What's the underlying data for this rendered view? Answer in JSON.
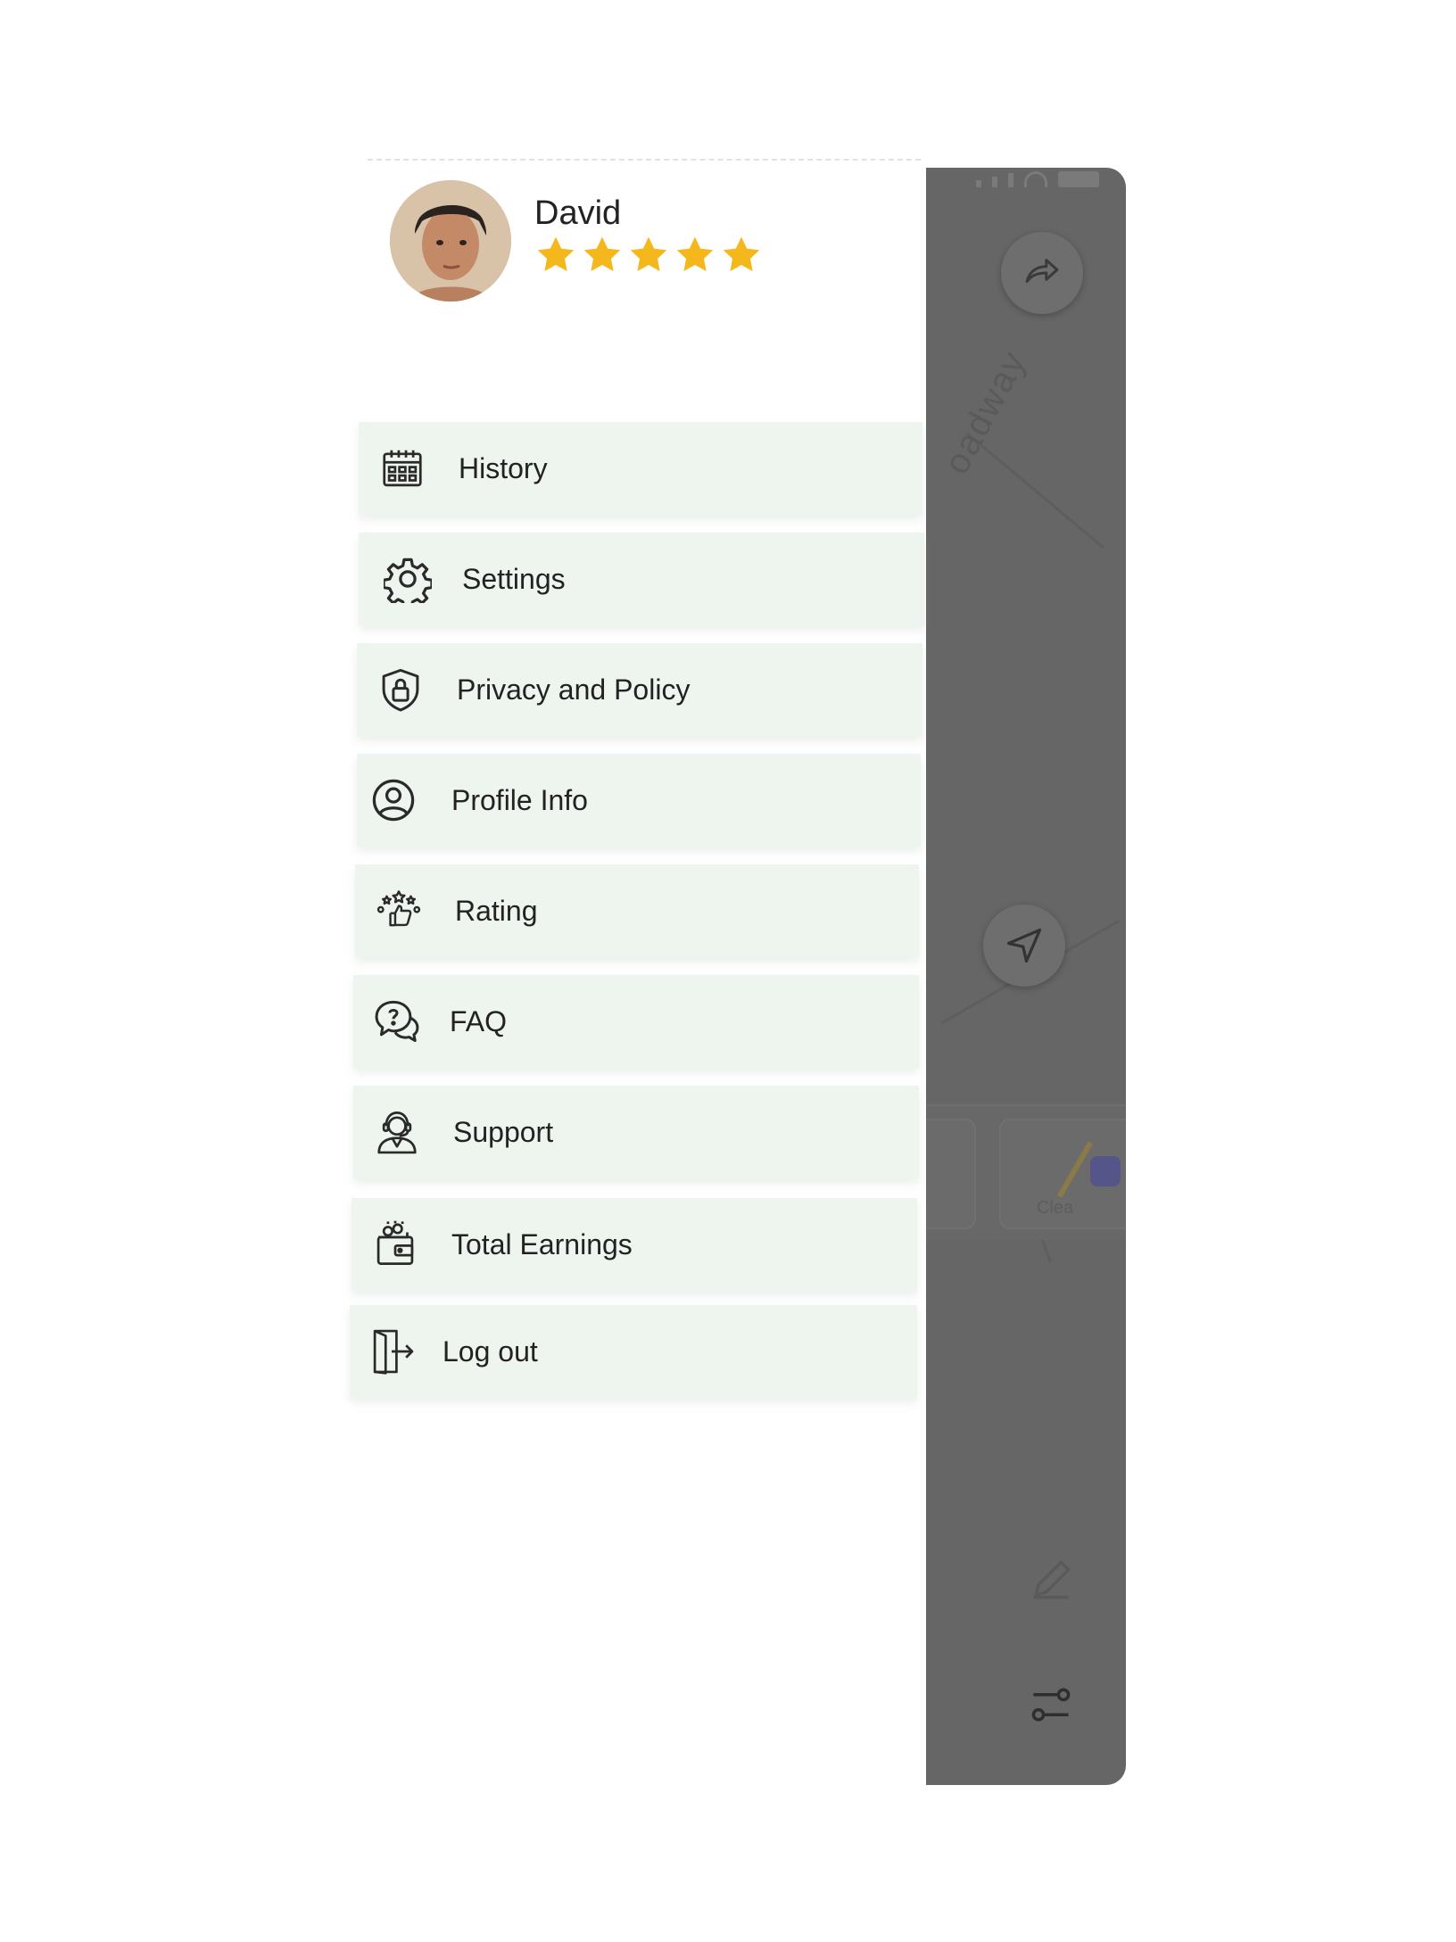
{
  "map": {
    "street_label": "oadway",
    "card_label": "Clea"
  },
  "user": {
    "name": "David",
    "rating": 5,
    "max_rating": 5
  },
  "menu": {
    "items": [
      {
        "label": "History",
        "icon": "calendar-icon"
      },
      {
        "label": "Settings",
        "icon": "gear-icon"
      },
      {
        "label": "Privacy and Policy",
        "icon": "shield-lock-icon"
      },
      {
        "label": "Profile Info",
        "icon": "user-circle-icon"
      },
      {
        "label": "Rating",
        "icon": "rating-thumbs-icon"
      },
      {
        "label": "FAQ",
        "icon": "faq-chat-icon"
      },
      {
        "label": "Support",
        "icon": "support-agent-icon"
      },
      {
        "label": "Total Earnings",
        "icon": "wallet-icon"
      },
      {
        "label": "Log out",
        "icon": "logout-icon"
      }
    ]
  },
  "colors": {
    "menu_bg": "#eef4ee",
    "star": "#f5b81c",
    "overlay": "#666666"
  }
}
